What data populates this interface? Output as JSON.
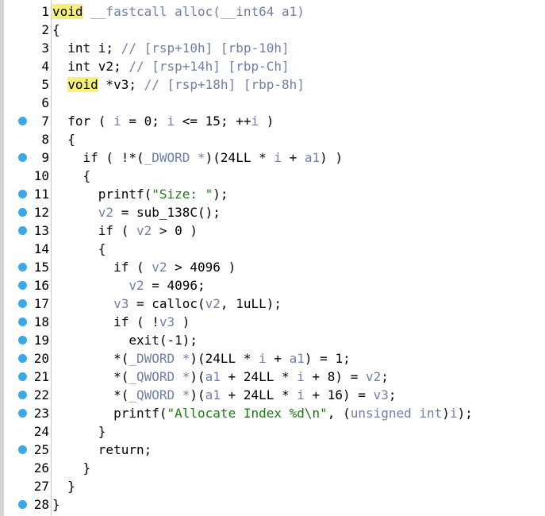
{
  "lines": [
    {
      "n": "1",
      "bp": false,
      "indent": "",
      "segments": [
        {
          "t": "void",
          "c": "kw-hl"
        },
        {
          "t": " __fastcall alloc(__int64 ",
          "c": "cm"
        },
        {
          "t": "a1",
          "c": "cm"
        },
        {
          "t": ")",
          "c": "cm"
        }
      ]
    },
    {
      "n": "2",
      "bp": false,
      "indent": "",
      "segments": [
        {
          "t": "{",
          "c": ""
        }
      ]
    },
    {
      "n": "3",
      "bp": false,
      "indent": "  ",
      "segments": [
        {
          "t": "int i; ",
          "c": ""
        },
        {
          "t": "// [rsp+10h] [rbp-10h]",
          "c": "cm"
        }
      ]
    },
    {
      "n": "4",
      "bp": false,
      "indent": "  ",
      "segments": [
        {
          "t": "int v2; ",
          "c": ""
        },
        {
          "t": "// [rsp+14h] [rbp-Ch]",
          "c": "cm"
        }
      ]
    },
    {
      "n": "5",
      "bp": false,
      "indent": "  ",
      "segments": [
        {
          "t": "void",
          "c": "kw-hl"
        },
        {
          "t": " *v3; ",
          "c": ""
        },
        {
          "t": "// [rsp+18h] [rbp-8h]",
          "c": "cm"
        }
      ]
    },
    {
      "n": "6",
      "bp": false,
      "indent": "",
      "segments": []
    },
    {
      "n": "7",
      "bp": true,
      "indent": "  ",
      "segments": [
        {
          "t": "for ( ",
          "c": ""
        },
        {
          "t": "i",
          "c": "vr"
        },
        {
          "t": " = 0; ",
          "c": ""
        },
        {
          "t": "i",
          "c": "vr"
        },
        {
          "t": " <= 15; ++",
          "c": ""
        },
        {
          "t": "i",
          "c": "vr"
        },
        {
          "t": " )",
          "c": ""
        }
      ]
    },
    {
      "n": "8",
      "bp": false,
      "indent": "  ",
      "segments": [
        {
          "t": "{",
          "c": ""
        }
      ]
    },
    {
      "n": "9",
      "bp": true,
      "indent": "    ",
      "segments": [
        {
          "t": "if ( !*(",
          "c": ""
        },
        {
          "t": "_DWORD *",
          "c": "tp"
        },
        {
          "t": ")(24LL * ",
          "c": ""
        },
        {
          "t": "i",
          "c": "vr"
        },
        {
          "t": " + ",
          "c": ""
        },
        {
          "t": "a1",
          "c": "vr"
        },
        {
          "t": ") )",
          "c": ""
        }
      ]
    },
    {
      "n": "10",
      "bp": false,
      "indent": "    ",
      "segments": [
        {
          "t": "{",
          "c": ""
        }
      ]
    },
    {
      "n": "11",
      "bp": true,
      "indent": "      ",
      "segments": [
        {
          "t": "printf(",
          "c": ""
        },
        {
          "t": "\"Size: \"",
          "c": "st"
        },
        {
          "t": ");",
          "c": ""
        }
      ]
    },
    {
      "n": "12",
      "bp": true,
      "indent": "      ",
      "segments": [
        {
          "t": "v2",
          "c": "vr"
        },
        {
          "t": " = sub_138C();",
          "c": ""
        }
      ]
    },
    {
      "n": "13",
      "bp": true,
      "indent": "      ",
      "segments": [
        {
          "t": "if ( ",
          "c": ""
        },
        {
          "t": "v2",
          "c": "vr"
        },
        {
          "t": " > 0 )",
          "c": ""
        }
      ]
    },
    {
      "n": "14",
      "bp": false,
      "indent": "      ",
      "segments": [
        {
          "t": "{",
          "c": ""
        }
      ]
    },
    {
      "n": "15",
      "bp": true,
      "indent": "        ",
      "segments": [
        {
          "t": "if ( ",
          "c": ""
        },
        {
          "t": "v2",
          "c": "vr"
        },
        {
          "t": " > 4096 )",
          "c": ""
        }
      ]
    },
    {
      "n": "16",
      "bp": true,
      "indent": "          ",
      "segments": [
        {
          "t": "v2",
          "c": "vr"
        },
        {
          "t": " = 4096;",
          "c": ""
        }
      ]
    },
    {
      "n": "17",
      "bp": true,
      "indent": "        ",
      "segments": [
        {
          "t": "v3",
          "c": "vr"
        },
        {
          "t": " = calloc(",
          "c": ""
        },
        {
          "t": "v2",
          "c": "vr"
        },
        {
          "t": ", 1uLL);",
          "c": ""
        }
      ]
    },
    {
      "n": "18",
      "bp": true,
      "indent": "        ",
      "segments": [
        {
          "t": "if ( !",
          "c": ""
        },
        {
          "t": "v3",
          "c": "vr"
        },
        {
          "t": " )",
          "c": ""
        }
      ]
    },
    {
      "n": "19",
      "bp": true,
      "indent": "          ",
      "segments": [
        {
          "t": "exit(-1);",
          "c": ""
        }
      ]
    },
    {
      "n": "20",
      "bp": true,
      "indent": "        ",
      "segments": [
        {
          "t": "*(",
          "c": ""
        },
        {
          "t": "_DWORD *",
          "c": "tp"
        },
        {
          "t": ")(24LL * ",
          "c": ""
        },
        {
          "t": "i",
          "c": "vr"
        },
        {
          "t": " + ",
          "c": ""
        },
        {
          "t": "a1",
          "c": "vr"
        },
        {
          "t": ") = 1;",
          "c": ""
        }
      ]
    },
    {
      "n": "21",
      "bp": true,
      "indent": "        ",
      "segments": [
        {
          "t": "*(",
          "c": ""
        },
        {
          "t": "_QWORD *",
          "c": "tp"
        },
        {
          "t": ")(",
          "c": ""
        },
        {
          "t": "a1",
          "c": "vr"
        },
        {
          "t": " + 24LL * ",
          "c": ""
        },
        {
          "t": "i",
          "c": "vr"
        },
        {
          "t": " + 8) = ",
          "c": ""
        },
        {
          "t": "v2",
          "c": "vr"
        },
        {
          "t": ";",
          "c": ""
        }
      ]
    },
    {
      "n": "22",
      "bp": true,
      "indent": "        ",
      "segments": [
        {
          "t": "*(",
          "c": ""
        },
        {
          "t": "_QWORD *",
          "c": "tp"
        },
        {
          "t": ")(",
          "c": ""
        },
        {
          "t": "a1",
          "c": "vr"
        },
        {
          "t": " + 24LL * ",
          "c": ""
        },
        {
          "t": "i",
          "c": "vr"
        },
        {
          "t": " + 16) = ",
          "c": ""
        },
        {
          "t": "v3",
          "c": "vr"
        },
        {
          "t": ";",
          "c": ""
        }
      ]
    },
    {
      "n": "23",
      "bp": true,
      "indent": "        ",
      "segments": [
        {
          "t": "printf(",
          "c": ""
        },
        {
          "t": "\"Allocate Index %d\\n\"",
          "c": "st"
        },
        {
          "t": ", (",
          "c": ""
        },
        {
          "t": "unsigned int",
          "c": "tp"
        },
        {
          "t": ")",
          "c": ""
        },
        {
          "t": "i",
          "c": "vr"
        },
        {
          "t": ");",
          "c": ""
        }
      ]
    },
    {
      "n": "24",
      "bp": false,
      "indent": "      ",
      "segments": [
        {
          "t": "}",
          "c": ""
        }
      ]
    },
    {
      "n": "25",
      "bp": true,
      "indent": "      ",
      "segments": [
        {
          "t": "return;",
          "c": ""
        }
      ]
    },
    {
      "n": "26",
      "bp": false,
      "indent": "    ",
      "segments": [
        {
          "t": "}",
          "c": ""
        }
      ]
    },
    {
      "n": "27",
      "bp": false,
      "indent": "  ",
      "segments": [
        {
          "t": "}",
          "c": ""
        }
      ]
    },
    {
      "n": "28",
      "bp": true,
      "indent": "",
      "segments": [
        {
          "t": "}",
          "c": ""
        }
      ]
    }
  ]
}
